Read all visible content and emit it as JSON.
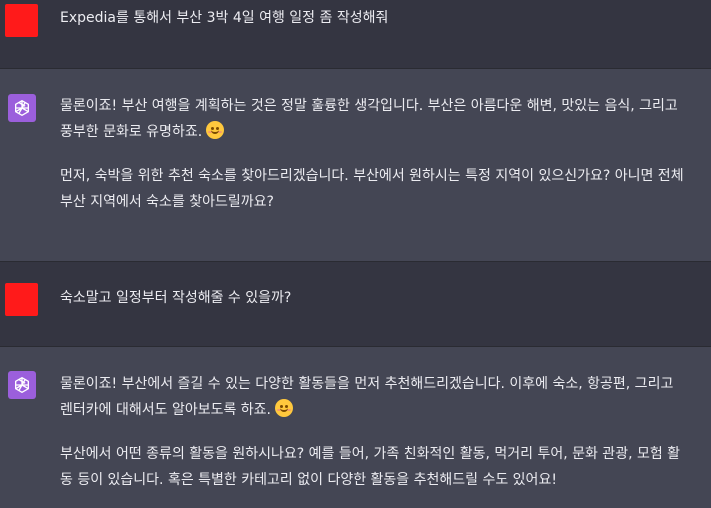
{
  "messages": [
    {
      "role": "user",
      "avatar_color": "#ff1a1a",
      "paragraphs": [
        "Expedia를 통해서 부산 3박 4일 여행 일정 좀 작성해줘"
      ]
    },
    {
      "role": "assistant",
      "avatar_icon": "openai-logo-icon",
      "avatar_color": "#9b5fdc",
      "paragraphs": [
        {
          "lines": [
            "물론이죠! 부산 여행을 계획하는 것은 정말 훌륭한 생각입니다. 부산은 아름다운 해변, 맛있는 음식, 그리고",
            "풍부한 문화로 유명하죠."
          ],
          "emoji": "smiling-face-emoji"
        },
        {
          "lines": [
            "먼저, 숙박을 위한 추천 숙소를 찾아드리겠습니다. 부산에서 원하시는 특정 지역이 있으신가요? 아니면 전체",
            "부산 지역에서 숙소를 찾아드릴까요?"
          ]
        }
      ]
    },
    {
      "role": "user",
      "avatar_color": "#ff1a1a",
      "paragraphs": [
        "숙소말고 일정부터 작성해줄 수 있을까?"
      ]
    },
    {
      "role": "assistant",
      "avatar_icon": "openai-logo-icon",
      "avatar_color": "#9b5fdc",
      "paragraphs": [
        {
          "lines": [
            "물론이죠! 부산에서 즐길 수 있는 다양한 활동들을 먼저 추천해드리겠습니다. 이후에 숙소, 항공편, 그리고",
            "렌터카에 대해서도 알아보도록 하죠."
          ],
          "emoji": "smiling-face-emoji"
        },
        {
          "lines": [
            "부산에서 어떤 종류의 활동을 원하시나요? 예를 들어, 가족 친화적인 활동, 먹거리 투어, 문화 관광, 모험 활",
            "동 등이 있습니다. 혹은 특별한 카테고리 없이 다양한 활동을 추천해드릴 수도 있어요!"
          ]
        }
      ]
    }
  ]
}
